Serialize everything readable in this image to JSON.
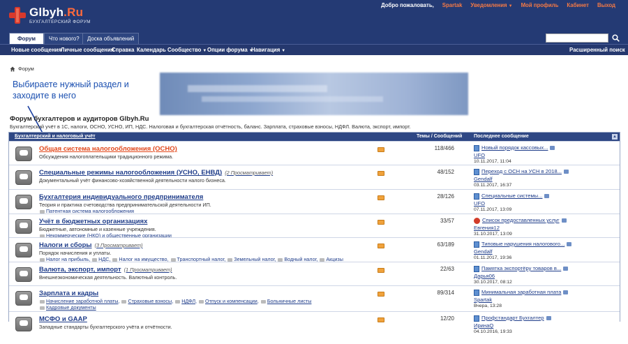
{
  "header": {
    "logo_main": "Glbyh",
    "logo_tld": ".Ru",
    "logo_sub": "БУХГАЛТЕРСКИЙ ФОРУМ",
    "welcome": "Добро пожаловать,",
    "user": "Spartak",
    "notifications": "Уведомления",
    "profile": "Мой профиль",
    "cabinet": "Кабинет",
    "logout": "Выход"
  },
  "tabs": [
    "Форум",
    "Что нового?",
    "Доска объявлений"
  ],
  "navbar": {
    "items": [
      "Новые сообщения",
      "Личные сообщения",
      "Справка",
      "Календарь",
      "Сообщество",
      "Опции форума",
      "Навигация"
    ],
    "advanced_search": "Расширенный поиск"
  },
  "breadcrumb": "Форум",
  "annotation": "Выбираете нужный раздел и заходите в него",
  "forum": {
    "title": "Форум бухгалтеров и аудиторов Glbyh.Ru",
    "description": "Бухгалтерский учёт в 1С, налоги, ОСНО, УСНО, ИП, НДС. Налоговая и бухгалтерская отчётность, баланс. Зарплата, страховые взносы, НДФЛ. Валюта, экспорт, импорт."
  },
  "table": {
    "header_section": "Бухгалтерский и налоговый учёт",
    "header_counts": "Темы / Сообщений",
    "header_last": "Последнее сообщение",
    "rows": [
      {
        "title": "Общая система налогообложения (ОСНО)",
        "viewing": "",
        "desc": "Обсуждения налогоплательщики традиционного режима.",
        "subs": [],
        "counts": "118/466",
        "last_title": "Новый порядок кассовых...",
        "last_user": "UFO",
        "last_date": "10.11.2017, 11:04"
      },
      {
        "title": "Специальные режимы налогообложения (УСНО, ЕНВД)",
        "viewing": "(2 Просматривает)",
        "desc": "Документальный учёт финансово-хозяйственной деятельности налого бизнеса.",
        "subs": [],
        "counts": "48/152",
        "last_title": "Переход с ОСН на УСН в 2018...",
        "last_user": "Gendalf",
        "last_date": "03.11.2017, 16:37"
      },
      {
        "title": "Бухгалтерия индивидуального предпринимателя",
        "viewing": "",
        "desc": "Теория и практика счетоводства предпринимательской деятельности ИП.",
        "subs": [
          "Патентная система налогообложения"
        ],
        "counts": "28/126",
        "last_title": "Специальные системы...",
        "last_user": "UFO",
        "last_date": "07.11.2017, 13:09"
      },
      {
        "title": "Учёт в бюджетных организациях",
        "viewing": "",
        "desc": "Бюджетные, автономные и казенные учреждения.",
        "subs": [
          "Некоммерческие (НКО) и общественные организации"
        ],
        "counts": "33/57",
        "last_title": "Список предоставленных услуг",
        "last_user": "Евгения12",
        "last_date": "31.10.2017, 13:09"
      },
      {
        "title": "Налоги и сборы",
        "viewing": "(3 Просматривает)",
        "desc": "Порядок начисления и уплаты.",
        "subs": [
          "Налог на прибыль",
          "НДС",
          "Налог на имущество",
          "Транспортный налог",
          "Земельный налог",
          "Водный налог",
          "Акцизы"
        ],
        "counts": "63/189",
        "last_title": "Типовые нарушения налогового...",
        "last_user": "Gendalf",
        "last_date": "01.11.2017, 19:36"
      },
      {
        "title": "Валюта, экспорт, импорт",
        "viewing": "(1 Просматривает)",
        "desc": "Внешнеэкономическая деятельность. Валютный контроль.",
        "subs": [],
        "counts": "22/63",
        "last_title": "Памятка экспортёру товаров в...",
        "last_user": "Дарья06",
        "last_date": "30.10.2017, 08:12"
      },
      {
        "title": "Зарплата и кадры",
        "viewing": "",
        "desc": "",
        "subs": [
          "Начисление заработной платы",
          "Страховые взносы",
          "НДФЛ",
          "Отпуск и компенсации",
          "Больничные листы",
          "Кадровые документы"
        ],
        "counts": "89/314",
        "last_title": "Минимальная заработная плата",
        "last_user": "Spartak",
        "last_date": "Вчера, 13:28"
      },
      {
        "title": "МСФО и GAAP",
        "viewing": "",
        "desc": "Западные стандарты бухгалтерского учёта и отчётности.",
        "subs": [],
        "counts": "12/20",
        "last_title": "Профстандарт Бухгалтер",
        "last_user": "ИринаQ",
        "last_date": "04.10.2016, 19:33"
      }
    ]
  },
  "colors": {
    "header_bg": "#243a74",
    "accent_orange": "#e2481b",
    "link_blue": "#1f3d8a"
  }
}
